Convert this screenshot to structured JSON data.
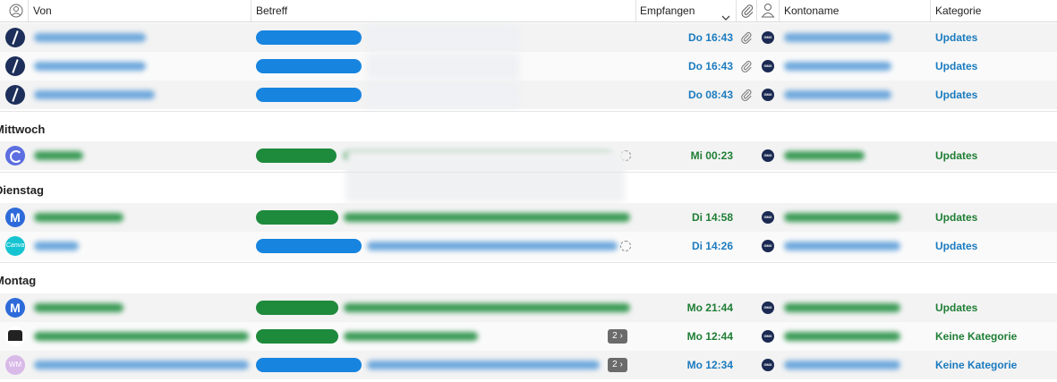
{
  "header": {
    "von": "Von",
    "betreff": "Betreff",
    "empfangen": "Empfangen",
    "kontoname": "Kontoname",
    "kategorie": "Kategorie"
  },
  "groups": {
    "mittwoch": "Mittwoch",
    "dienstag": "Dienstag",
    "montag": "Montag"
  },
  "rows": [
    {
      "date": "Do 16:43",
      "category": "Updates",
      "color": "#1a7bbf"
    },
    {
      "date": "Do 16:43",
      "category": "Updates",
      "color": "#1a7bbf"
    },
    {
      "date": "Do 08:43",
      "category": "Updates",
      "color": "#1a7bbf"
    },
    {
      "date": "Mi 00:23",
      "category": "Updates",
      "color": "#1e7e34"
    },
    {
      "date": "Di 14:58",
      "category": "Updates",
      "color": "#1e7e34"
    },
    {
      "date": "Di 14:26",
      "category": "Updates",
      "color": "#1a7bbf"
    },
    {
      "date": "Mo 21:44",
      "category": "Updates",
      "color": "#1e7e34"
    },
    {
      "date": "Mo 12:44",
      "category": "Keine Kategorie",
      "color": "#1e7e34"
    },
    {
      "date": "Mo 12:34",
      "category": "Keine Kategorie",
      "color": "#1a7bbf"
    }
  ],
  "thread_counts": [
    "2 ›",
    "2 ›"
  ],
  "account_badge": "GMX",
  "icons": [
    "person-circle-icon",
    "chevron-down-icon",
    "paperclip-icon",
    "person-icon",
    "gmx-badge-icon"
  ]
}
